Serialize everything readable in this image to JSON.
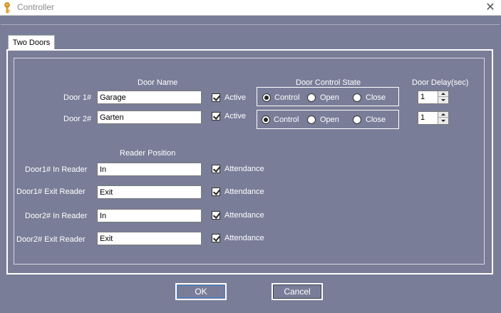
{
  "window": {
    "title": "Controller",
    "close_icon": "close-icon",
    "app_icon": "key-icon"
  },
  "tab": {
    "label": "Two Doors"
  },
  "headers": {
    "door_name": "Door Name",
    "door_control_state": "Door Control State",
    "door_delay": "Door Delay(sec)",
    "reader_position": "Reader Position"
  },
  "doors": [
    {
      "label": "Door 1#",
      "name": "Garage",
      "active_label": "Active",
      "active": true,
      "control_label": "Control",
      "open_label": "Open",
      "close_label": "Close",
      "state": "Control",
      "delay": "1"
    },
    {
      "label": "Door 2#",
      "name": "Garten",
      "active_label": "Active",
      "active": true,
      "control_label": "Control",
      "open_label": "Open",
      "close_label": "Close",
      "state": "Control",
      "delay": "1"
    }
  ],
  "readers": [
    {
      "label": "Door1# In Reader",
      "value": "In",
      "attendance_label": "Attendance",
      "attendance": true
    },
    {
      "label": "Door1# Exit Reader",
      "value": "Exit",
      "attendance_label": "Attendance",
      "attendance": true
    },
    {
      "label": "Door2# In Reader",
      "value": "In",
      "attendance_label": "Attendance",
      "attendance": true
    },
    {
      "label": "Door2# Exit Reader",
      "value": "Exit",
      "attendance_label": "Attendance",
      "attendance": true
    }
  ],
  "buttons": {
    "ok": "OK",
    "cancel": "Cancel"
  },
  "colors": {
    "background": "#7a7d98",
    "focus": "#3b7fd6"
  }
}
